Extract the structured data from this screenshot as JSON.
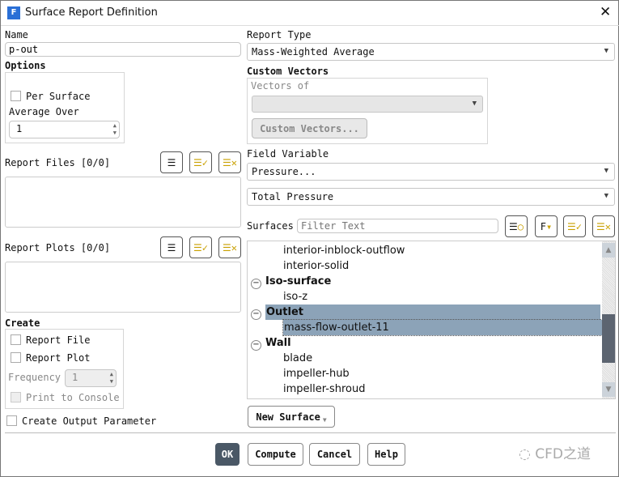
{
  "window": {
    "title": "Surface Report Definition",
    "logo": "F"
  },
  "name": {
    "label": "Name",
    "value": "p-out"
  },
  "options": {
    "label": "Options",
    "per_surface": "Per Surface",
    "average_over": "Average Over",
    "average_value": "1"
  },
  "report_files": {
    "label": "Report Files [0/0]"
  },
  "report_plots": {
    "label": "Report Plots [0/0]"
  },
  "create": {
    "label": "Create",
    "report_file": "Report File",
    "report_plot": "Report Plot",
    "frequency": "Frequency",
    "frequency_value": "1",
    "print": "Print to Console"
  },
  "create_output": "Create Output Parameter",
  "report_type": {
    "label": "Report Type",
    "value": "Mass-Weighted Average"
  },
  "custom_vectors": {
    "label": "Custom Vectors",
    "vectors_of": "Vectors of",
    "button": "Custom Vectors..."
  },
  "field_variable": {
    "label": "Field Variable",
    "category": "Pressure...",
    "value": "Total Pressure"
  },
  "surfaces": {
    "label": "Surfaces",
    "filter_placeholder": "Filter Text",
    "rows": [
      {
        "text": "interior-inblock-outflow",
        "type": "item"
      },
      {
        "text": "interior-solid",
        "type": "item"
      },
      {
        "text": "Iso-surface",
        "type": "group"
      },
      {
        "text": "iso-z",
        "type": "item"
      },
      {
        "text": "Outlet",
        "type": "group",
        "selected": true
      },
      {
        "text": "mass-flow-outlet-11",
        "type": "item",
        "selected": true
      },
      {
        "text": "Wall",
        "type": "group"
      },
      {
        "text": "blade",
        "type": "item"
      },
      {
        "text": "impeller-hub",
        "type": "item"
      },
      {
        "text": "impeller-shroud",
        "type": "item"
      }
    ],
    "new_surface": "New Surface"
  },
  "buttons": {
    "ok": "OK",
    "compute": "Compute",
    "cancel": "Cancel",
    "help": "Help"
  },
  "watermark": "CFD之道",
  "colors": {
    "selection": "#8ca3b8",
    "ok": "#4a5866",
    "scroll_thumb": "#5c6470"
  }
}
